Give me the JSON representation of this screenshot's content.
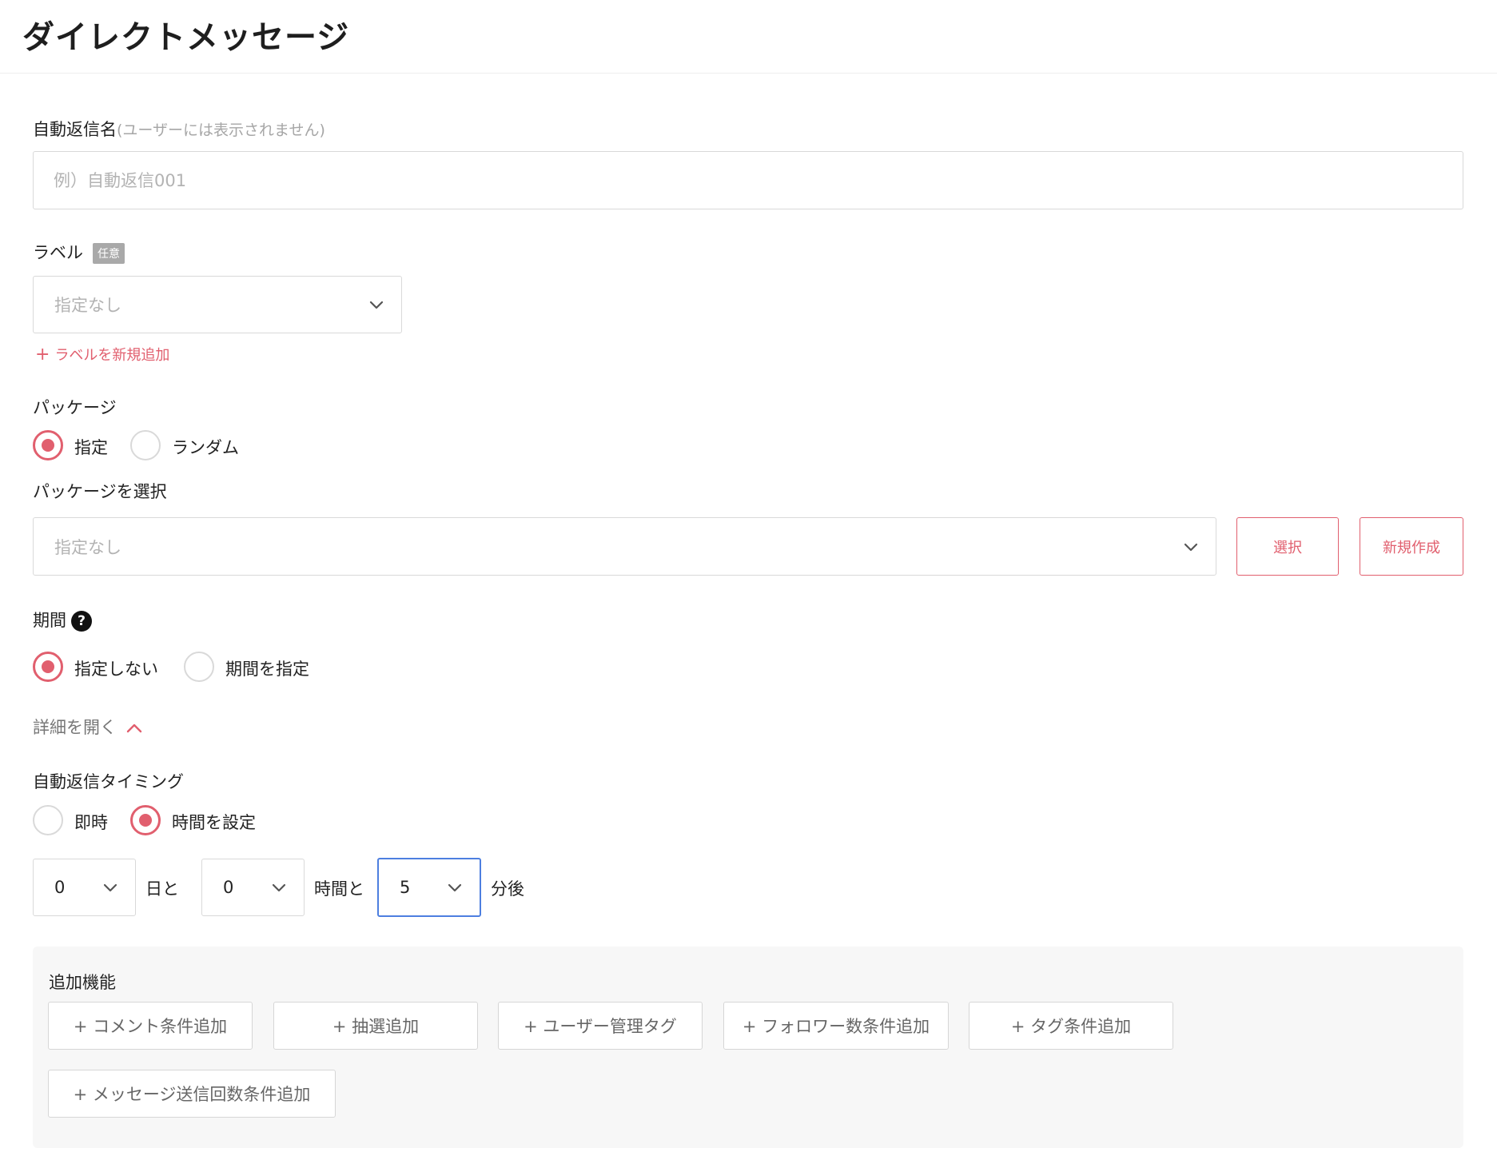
{
  "header": {
    "title": "ダイレクトメッセージ"
  },
  "form": {
    "name": {
      "label": "自動返信名",
      "note": "(ユーザーには表示されません)",
      "placeholder": "例）自動返信001"
    },
    "label_field": {
      "label": "ラベル",
      "badge": "任意",
      "select_value": "指定なし",
      "add_link": "ラベルを新規追加",
      "add_plus": "+"
    },
    "package": {
      "label": "パッケージ",
      "options": [
        {
          "label": "指定",
          "selected": true
        },
        {
          "label": "ランダム",
          "selected": false
        }
      ],
      "select_label": "パッケージを選択",
      "select_value": "指定なし",
      "select_button": "選択",
      "create_button": "新規作成"
    },
    "period": {
      "label": "期間",
      "help": "?",
      "options": [
        {
          "label": "指定しない",
          "selected": true
        },
        {
          "label": "期間を指定",
          "selected": false
        }
      ]
    },
    "detail_toggle": "詳細を開く",
    "timing": {
      "label": "自動返信タイミング",
      "options": [
        {
          "label": "即時",
          "selected": false
        },
        {
          "label": "時間を設定",
          "selected": true
        }
      ],
      "days_value": "0",
      "days_suffix": "日と",
      "hours_value": "0",
      "hours_suffix": "時間と",
      "minutes_value": "5",
      "minutes_suffix": "分後"
    },
    "extras": {
      "label": "追加機能",
      "buttons": [
        "+ コメント条件追加",
        "+ 抽選追加",
        "+ ユーザー管理タグ",
        "+ フォロワー数条件追加",
        "+ タグ条件追加",
        "+ メッセージ送信回数条件追加"
      ]
    }
  },
  "colors": {
    "accent": "#e15f6e",
    "focus": "#4d7fe0",
    "border": "#d9d9d9",
    "panel": "#f7f7f7"
  },
  "icons": {
    "chevron": "chevron-down-icon",
    "toggle": "chevron-up-icon",
    "help": "question-circle-icon"
  }
}
